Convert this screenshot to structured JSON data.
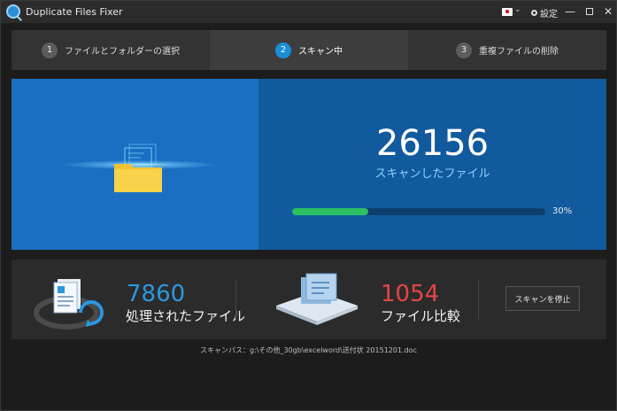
{
  "titlebar": {
    "app_title": "Duplicate Files Fixer",
    "language_icon": "japan-flag-icon",
    "settings_label": "設定",
    "minimize_icon": "minimize-icon",
    "maximize_icon": "maximize-icon",
    "close_icon": "close-icon"
  },
  "steps": [
    {
      "number": "1",
      "label": "ファイルとフォルダーの選択",
      "active": false
    },
    {
      "number": "2",
      "label": "スキャン中",
      "active": true
    },
    {
      "number": "3",
      "label": "重複ファイルの削除",
      "active": false
    }
  ],
  "scan": {
    "files_scanned": "26156",
    "files_scanned_label": "スキャンしたファイル",
    "progress_percent": 30,
    "progress_text": "30%"
  },
  "stats": {
    "processed_count": "7860",
    "processed_label": "処理されたファイル",
    "compared_count": "1054",
    "compared_label": "ファイル比較",
    "stop_button_label": "スキャンを停止"
  },
  "scan_path_text": "スキャンパス：g:\\その他_30gb\\excelword\\送付状 20151201.doc",
  "colors": {
    "accent_blue": "#1a8fd8",
    "scan_left_bg": "#1a6fc2",
    "scan_right_bg": "#125a9e",
    "progress_green": "#2bc062",
    "processed_blue": "#2a97e0",
    "compared_red": "#e54545"
  }
}
